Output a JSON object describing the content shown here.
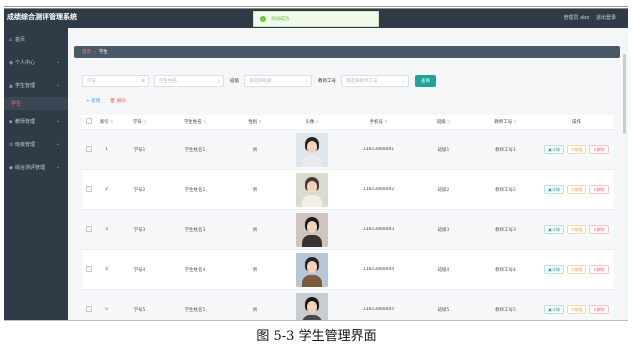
{
  "app": {
    "title": "成绩综合测评管理系统",
    "admin_label": "管理员 abo",
    "logout_label": "退出登录"
  },
  "toast": {
    "message": "添加成功"
  },
  "sidebar": {
    "items": [
      {
        "label": "首页",
        "icon": "home-icon"
      },
      {
        "label": "个人中心",
        "icon": "user-icon",
        "chev": "⌄"
      },
      {
        "label": "学生管理",
        "icon": "student-icon",
        "chev": "⌄",
        "expanded": true,
        "sub": "学生"
      },
      {
        "label": "教师管理",
        "icon": "teacher-icon",
        "chev": "⌄"
      },
      {
        "label": "班级管理",
        "icon": "class-icon",
        "chev": "⌄"
      },
      {
        "label": "综合测评管理",
        "icon": "evaluation-icon",
        "chev": "⌄"
      }
    ]
  },
  "breadcrumb": {
    "home": "首页",
    "current": "学生"
  },
  "filters": {
    "student_no_placeholder": "学号",
    "student_name_placeholder": "学生姓名",
    "class_label": "班级",
    "class_placeholder": "请选择班级",
    "teacher_label": "教师工号",
    "teacher_placeholder": "请选择教师工号",
    "search_label": "查询"
  },
  "actions": {
    "add_label": "+ 新增",
    "delete_label": "删除"
  },
  "table": {
    "headers": [
      "索引",
      "学号",
      "学生姓名",
      "性别",
      "头像",
      "手机号",
      "班级",
      "教师工号",
      "操作"
    ],
    "rows": [
      {
        "index": "1",
        "no": "学号1",
        "name": "学生姓名1",
        "gender": "男",
        "phone": "13823888881",
        "class": "班级1",
        "teacher": "教师工号1"
      },
      {
        "index": "2",
        "no": "学号2",
        "name": "学生姓名2",
        "gender": "男",
        "phone": "13823888882",
        "class": "班级2",
        "teacher": "教师工号2"
      },
      {
        "index": "3",
        "no": "学号3",
        "name": "学生姓名3",
        "gender": "男",
        "phone": "13823888883",
        "class": "班级3",
        "teacher": "教师工号3"
      },
      {
        "index": "4",
        "no": "学号4",
        "name": "学生姓名4",
        "gender": "男",
        "phone": "13823888884",
        "class": "班级4",
        "teacher": "教师工号4"
      },
      {
        "index": "5",
        "no": "学号5",
        "name": "学生姓名5",
        "gender": "男",
        "phone": "13823888885",
        "class": "班级5",
        "teacher": "教师工号5"
      }
    ],
    "op_labels": {
      "view": "详情",
      "edit": "修改",
      "delete": "删除"
    }
  },
  "caption": "图 5-3 学生管理界面"
}
